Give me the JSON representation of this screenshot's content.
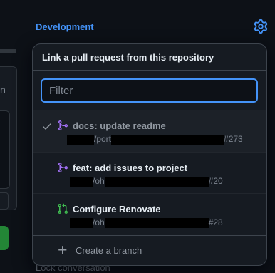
{
  "sidebar": {
    "development_label": "Development",
    "background_letter": "n",
    "lock_text": "Lock conversation"
  },
  "popover": {
    "header": "Link a pull request from this repository",
    "filter": {
      "placeholder": "Filter",
      "value": ""
    },
    "items": [
      {
        "title": "docs: update readme",
        "repo_prefix": "/port",
        "number": "#273",
        "selected": true,
        "icon": "merged-pr-icon",
        "icon_color": "#a371f7"
      },
      {
        "title": "feat: add issues to project",
        "repo_prefix": "/oh",
        "number": "#20",
        "selected": false,
        "icon": "merged-pr-icon",
        "icon_color": "#a371f7"
      },
      {
        "title": "Configure Renovate",
        "repo_prefix": "/oh",
        "number": "#28",
        "selected": false,
        "icon": "open-pr-icon",
        "icon_color": "#3fb950"
      }
    ],
    "create_branch_label": "Create a branch"
  },
  "colors": {
    "accent": "#4493f8",
    "background": "#0d1117",
    "panel": "#161b22",
    "merged": "#a371f7",
    "open": "#3fb950"
  }
}
